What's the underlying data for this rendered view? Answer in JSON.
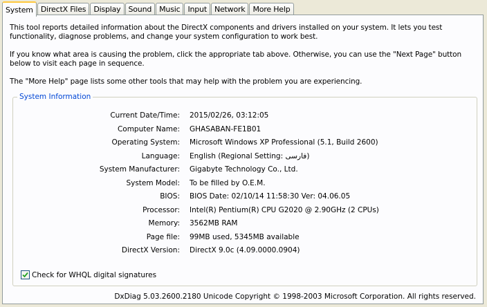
{
  "tabs": [
    "System",
    "DirectX Files",
    "Display",
    "Sound",
    "Music",
    "Input",
    "Network",
    "More Help"
  ],
  "intro": {
    "p1": "This tool reports detailed information about the DirectX components and drivers installed on your system.  It lets you test functionality, diagnose problems, and change your system configuration to work best.",
    "p2": "If you know what area is causing the problem, click the appropriate tab above.  Otherwise, you can use the \"Next Page\" button below to visit each page in sequence.",
    "p3": "The \"More Help\" page lists some other tools that may help with the problem you are experiencing."
  },
  "system_info": {
    "title": "System Information",
    "rows": [
      {
        "label": "Current Date/Time:",
        "value": "2015/02/26, 03:12:05"
      },
      {
        "label": "Computer Name:",
        "value": "GHASABAN-FE1B01"
      },
      {
        "label": "Operating System:",
        "value": "Microsoft Windows XP Professional (5.1, Build 2600)"
      },
      {
        "label": "Language:",
        "value": "English (Regional Setting: فارسی)"
      },
      {
        "label": "System Manufacturer:",
        "value": "Gigabyte Technology Co., Ltd."
      },
      {
        "label": "System Model:",
        "value": "To be filled by O.E.M."
      },
      {
        "label": "BIOS:",
        "value": "BIOS Date: 02/10/14 11:58:30 Ver: 04.06.05"
      },
      {
        "label": "Processor:",
        "value": "Intel(R) Pentium(R) CPU G2020 @ 2.90GHz (2 CPUs)"
      },
      {
        "label": "Memory:",
        "value": "3562MB RAM"
      },
      {
        "label": "Page file:",
        "value": "99MB used, 5345MB available"
      },
      {
        "label": "DirectX Version:",
        "value": "DirectX 9.0c (4.09.0000.0904)"
      }
    ],
    "whql_label": "Check for WHQL digital signatures",
    "whql_checked": true
  },
  "footer": "DxDiag 5.03.2600.2180 Unicode  Copyright © 1998-2003 Microsoft Corporation.  All rights reserved."
}
